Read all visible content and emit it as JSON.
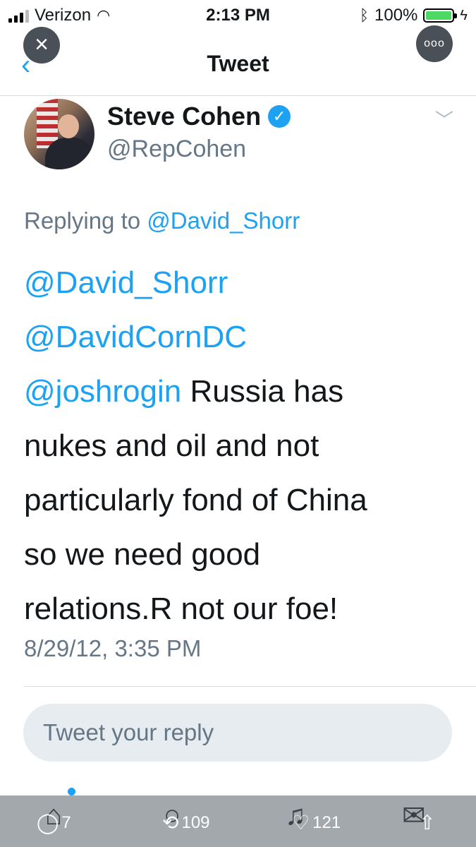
{
  "status_bar": {
    "carrier": "Verizon",
    "time": "2:13 PM",
    "battery": "100%"
  },
  "nav": {
    "title": "Tweet",
    "close_icon": "×",
    "more_icon": "ooo"
  },
  "tweet": {
    "author_name": "Steve Cohen",
    "author_handle": "@RepCohen",
    "replying_prefix": "Replying to",
    "replying_to": "@David_Shorr",
    "mention1": "@David_Shorr",
    "mention2": "@DavidCornDC",
    "mention3": "@joshrogin",
    "line3_text": " Russia has",
    "line4": "nukes and oil and not",
    "line5": "particularly fond of China",
    "line6": "so we need good",
    "line7": "relations.R not our foe!",
    "timestamp": "8/29/12, 3:35 PM"
  },
  "reply": {
    "placeholder": "Tweet your reply"
  },
  "actions": {
    "replies": "7",
    "retweets": "109",
    "likes": "121"
  },
  "colors": {
    "accent": "#1da1f2",
    "muted": "#657786"
  }
}
